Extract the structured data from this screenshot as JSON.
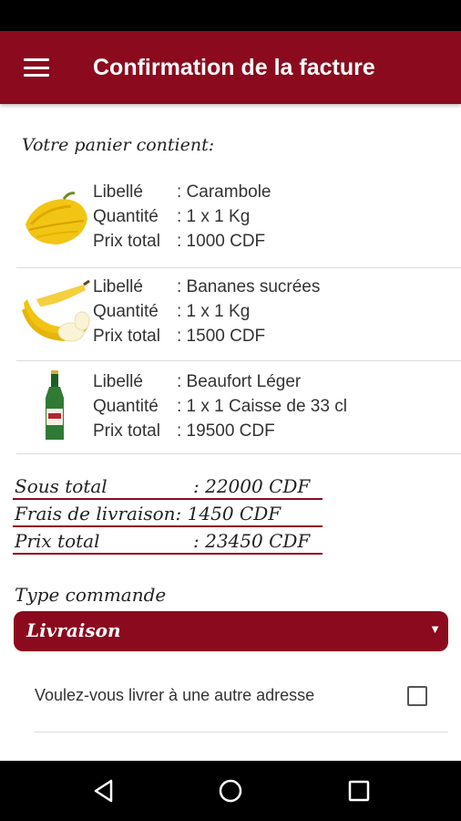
{
  "app_bar": {
    "title": "Confirmation de la facture",
    "menu_icon": "hamburger-menu-icon"
  },
  "cart": {
    "heading": "Votre panier contient:",
    "items": [
      {
        "image": "star-fruit",
        "label_key": "Libellé",
        "label_value": ": Carambole",
        "qty_key": "Quantité",
        "qty_value": ": 1 x 1 Kg",
        "price_key": "Prix total",
        "price_value": ": 1000 CDF"
      },
      {
        "image": "bananas",
        "label_key": "Libellé",
        "label_value": ": Bananes sucrées",
        "qty_key": "Quantité",
        "qty_value": ": 1 x 1 Kg",
        "price_key": "Prix total",
        "price_value": ": 1500 CDF"
      },
      {
        "image": "beer-bottle",
        "label_key": "Libellé",
        "label_value": ": Beaufort Léger",
        "qty_key": "Quantité",
        "qty_value": ": 1 x 1 Caisse de 33 cl",
        "price_key": "Prix total",
        "price_value": ": 19500 CDF"
      }
    ]
  },
  "totals": {
    "subtotal_label": "Sous total",
    "subtotal_value": ": 22000 CDF",
    "delivery_label": "Frais de livraison",
    "delivery_value": ": 1450 CDF",
    "total_label": "Prix total",
    "total_value": ": 23450 CDF"
  },
  "order_type": {
    "label": "Type commande",
    "selected": "Livraison"
  },
  "other_address": {
    "label": "Voulez-vous livrer à une autre adresse",
    "checked": false
  },
  "colors": {
    "primary": "#8b0a1e",
    "status_bar": "#000000",
    "nav_bar": "#000000"
  },
  "nav": {
    "back_icon": "back-triangle-icon",
    "home_icon": "home-circle-icon",
    "recents_icon": "recents-square-icon"
  }
}
